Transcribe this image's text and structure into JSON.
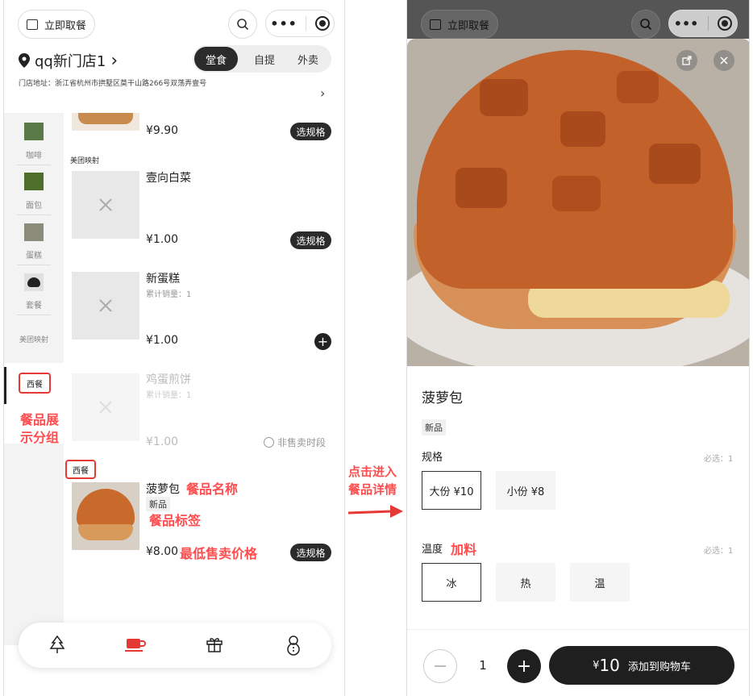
{
  "left": {
    "pickup_label": "立即取餐",
    "store_name": "qq新门店1",
    "store_chevron": "›",
    "modes": [
      "堂食",
      "自提",
      "外卖"
    ],
    "address": "门店地址：浙江省杭州市拱墅区莫干山路266号双荡弄壹号",
    "categories": [
      "咖啡",
      "面包",
      "蛋糕",
      "套餐",
      "美团映射",
      "西餐"
    ],
    "annotation_group": "餐品展\n示分组",
    "items": {
      "top_price": "¥9.90",
      "top_button": "选规格",
      "section_label": "美团映射",
      "baicai_name": "壹向白菜",
      "baicai_price": "¥1.00",
      "baicai_button": "选规格",
      "dangao_name": "新蛋糕",
      "dangao_sales": "累计销量：1",
      "dangao_price": "¥1.00",
      "jidan_name": "鸡蛋煎饼",
      "jidan_sales": "累计销量：1",
      "jidan_price": "¥1.00",
      "jidan_status": "非售卖时段",
      "west_label": "西餐",
      "boluo_name": "菠萝包",
      "boluo_tag": "新品",
      "boluo_price": "¥8.00",
      "boluo_button": "选规格"
    },
    "annotations": {
      "name": "餐品名称",
      "tag": "餐品标签",
      "price": "最低售卖价格"
    }
  },
  "arrow_label": "点击进入\n餐品详情",
  "right": {
    "pickup_label": "立即取餐",
    "product_name": "菠萝包",
    "product_tag": "新品",
    "spec_title": "规格",
    "spec_required": "必选：1",
    "spec_options": [
      "大份 ¥10",
      "小份 ¥8"
    ],
    "temp_title": "温度",
    "temp_annotation": "加料",
    "temp_required": "必选：1",
    "temp_options": [
      "冰",
      "热",
      "温"
    ],
    "quantity": "1",
    "total_currency": "¥",
    "total_value": "10",
    "add_to_cart": "添加到购物车"
  }
}
